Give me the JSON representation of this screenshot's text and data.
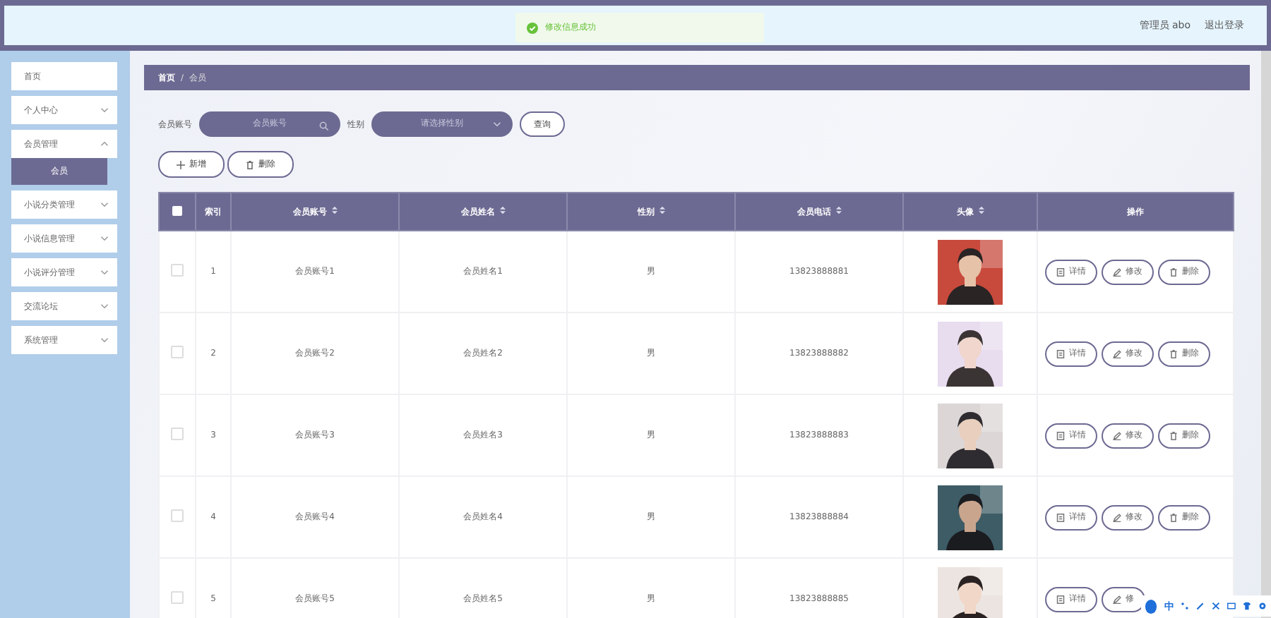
{
  "toast": {
    "message": "修改信息成功"
  },
  "header": {
    "user": "管理员 abo",
    "logout": "退出登录"
  },
  "sidebar": {
    "items": [
      {
        "label": "首页",
        "kind": "link"
      },
      {
        "label": "个人中心",
        "kind": "group",
        "expanded": false
      },
      {
        "label": "会员管理",
        "kind": "group",
        "expanded": true,
        "children": [
          {
            "label": "会员",
            "selected": true
          }
        ]
      },
      {
        "label": "小说分类管理",
        "kind": "group",
        "expanded": false
      },
      {
        "label": "小说信息管理",
        "kind": "group",
        "expanded": false
      },
      {
        "label": "小说评分管理",
        "kind": "group",
        "expanded": false
      },
      {
        "label": "交流论坛",
        "kind": "group",
        "expanded": false
      },
      {
        "label": "系统管理",
        "kind": "group",
        "expanded": false
      }
    ]
  },
  "breadcrumb": {
    "items": [
      "首页",
      "会员"
    ],
    "separator": "/"
  },
  "search": {
    "account_label": "会员账号",
    "account_placeholder": "会员账号",
    "gender_label": "性别",
    "gender_placeholder": "请选择性别",
    "query_button": "查询"
  },
  "actions": {
    "add": "新增",
    "delete": "删除"
  },
  "table": {
    "all_checked": false,
    "columns": [
      {
        "label": "索引",
        "sortable": false
      },
      {
        "label": "会员账号",
        "sortable": true
      },
      {
        "label": "会员姓名",
        "sortable": true
      },
      {
        "label": "性别",
        "sortable": true
      },
      {
        "label": "会员电话",
        "sortable": true
      },
      {
        "label": "头像",
        "sortable": true
      },
      {
        "label": "操作",
        "sortable": false
      }
    ],
    "rows": [
      {
        "index": "1",
        "account": "会员账号1",
        "name": "会员姓名1",
        "gender": "男",
        "phone": "13823888881",
        "avatar": {
          "kind": "picture"
        },
        "checked": false,
        "buttons": [
          "详情",
          "修改",
          "删除"
        ]
      },
      {
        "index": "2",
        "account": "会员账号2",
        "name": "会员姓名2",
        "gender": "男",
        "phone": "13823888882",
        "avatar": {
          "kind": "picture"
        },
        "checked": false,
        "buttons": [
          "详情",
          "修改",
          "删除"
        ]
      },
      {
        "index": "3",
        "account": "会员账号3",
        "name": "会员姓名3",
        "gender": "男",
        "phone": "13823888883",
        "avatar": {
          "kind": "picture"
        },
        "checked": false,
        "buttons": [
          "详情",
          "修改",
          "删除"
        ]
      },
      {
        "index": "4",
        "account": "会员账号4",
        "name": "会员姓名4",
        "gender": "男",
        "phone": "13823888884",
        "avatar": {
          "kind": "picture"
        },
        "checked": false,
        "buttons": [
          "详情",
          "修改",
          "删除"
        ]
      },
      {
        "index": "5",
        "account": "会员账号5",
        "name": "会员姓名5",
        "gender": "男",
        "phone": "13823888885",
        "avatar": {
          "kind": "picture"
        },
        "checked": false,
        "buttons": [
          "详情",
          "修"
        ]
      }
    ]
  },
  "ime_bar": {
    "mode": "中"
  }
}
